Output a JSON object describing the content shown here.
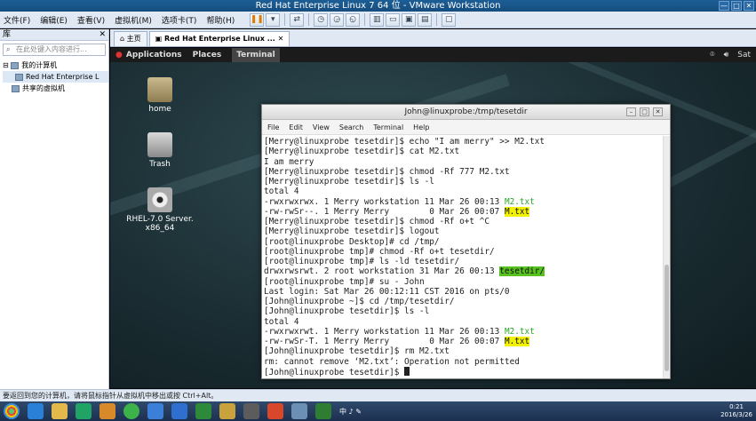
{
  "window": {
    "title": "Red Hat Enterprise Linux 7 64 位 - VMware Workstation",
    "controls": [
      "—",
      "□",
      "✕"
    ]
  },
  "menu": {
    "items": [
      "文件(F)",
      "编辑(E)",
      "查看(V)",
      "虚拟机(M)",
      "选项卡(T)",
      "帮助(H)"
    ]
  },
  "library": {
    "title": "库",
    "close": "✕",
    "search_placeholder": "在此处键入内容进行...",
    "my_computer": "我的计算机",
    "vm_item": "Red Hat Enterprise L",
    "shared_vms": "共享的虚拟机"
  },
  "tabs": [
    {
      "label": "主页"
    },
    {
      "label": "Red Hat Enterprise Linux ... ✕"
    }
  ],
  "gnome": {
    "applications": "Applications",
    "places": "Places",
    "terminal": "Terminal",
    "clock": "Sat"
  },
  "desktop": {
    "home": "home",
    "trash": "Trash",
    "disc_line1": "RHEL-7.0 Server.",
    "disc_line2": "x86_64"
  },
  "terminal": {
    "title": "John@linuxprobe:/tmp/tesetdir",
    "menu": [
      "File",
      "Edit",
      "View",
      "Search",
      "Terminal",
      "Help"
    ],
    "lines": [
      {
        "t": "[Merry@linuxprobe tesetdir]$ echo \"I am merry\" >> M2.txt"
      },
      {
        "t": "[Merry@linuxprobe tesetdir]$ cat M2.txt"
      },
      {
        "t": "I am merry"
      },
      {
        "t": "[Merry@linuxprobe tesetdir]$ chmod -Rf 777 M2.txt"
      },
      {
        "t": "[Merry@linuxprobe tesetdir]$ ls -l"
      },
      {
        "t": "total 4"
      },
      {
        "t": "-rwxrwxrwx. 1 Merry workstation 11 Mar 26 00:13 ",
        "h": "M2.txt",
        "c": "green"
      },
      {
        "t": "-rw-rwSr--. 1 Merry Merry        0 Mar 26 00:07 ",
        "h": "M.txt",
        "c": "yellow"
      },
      {
        "t": "[Merry@linuxprobe tesetdir]$ chmod -Rf o+t ^C"
      },
      {
        "t": "[Merry@linuxprobe tesetdir]$ logout"
      },
      {
        "t": "[root@linuxprobe Desktop]# cd /tmp/"
      },
      {
        "t": "[root@linuxprobe tmp]# chmod -Rf o+t tesetdir/"
      },
      {
        "t": "[root@linuxprobe tmp]# ls -ld tesetdir/"
      },
      {
        "t": "drwxrwsrwt. 2 root workstation 31 Mar 26 00:13 ",
        "h": "tesetdir/",
        "c": "greenbg"
      },
      {
        "t": "[root@linuxprobe tmp]# su - John"
      },
      {
        "t": "Last login: Sat Mar 26 00:12:11 CST 2016 on pts/0"
      },
      {
        "t": "[John@linuxprobe ~]$ cd /tmp/tesetdir/"
      },
      {
        "t": "[John@linuxprobe tesetdir]$ ls -l"
      },
      {
        "t": "total 4"
      },
      {
        "t": "-rwxrwxrwt. 1 Merry workstation 11 Mar 26 00:13 ",
        "h": "M2.txt",
        "c": "green"
      },
      {
        "t": "-rw-rwSr-T. 1 Merry Merry        0 Mar 26 00:07 ",
        "h": "M.txt",
        "c": "yellow"
      },
      {
        "t": "[John@linuxprobe tesetdir]$ rm M2.txt"
      },
      {
        "t": "rm: cannot remove ‘M2.txt’: Operation not permitted"
      },
      {
        "t": "[John@linuxprobe tesetdir]$ ",
        "cursor": true
      }
    ]
  },
  "status": {
    "text": "要返回到您的计算机，请将鼠标指针从虚拟机中移出或按 Ctrl+Alt。"
  },
  "taskbar": {
    "time": "0:21",
    "date": "2016/3/26",
    "tray": "中 ♪ ✎"
  }
}
